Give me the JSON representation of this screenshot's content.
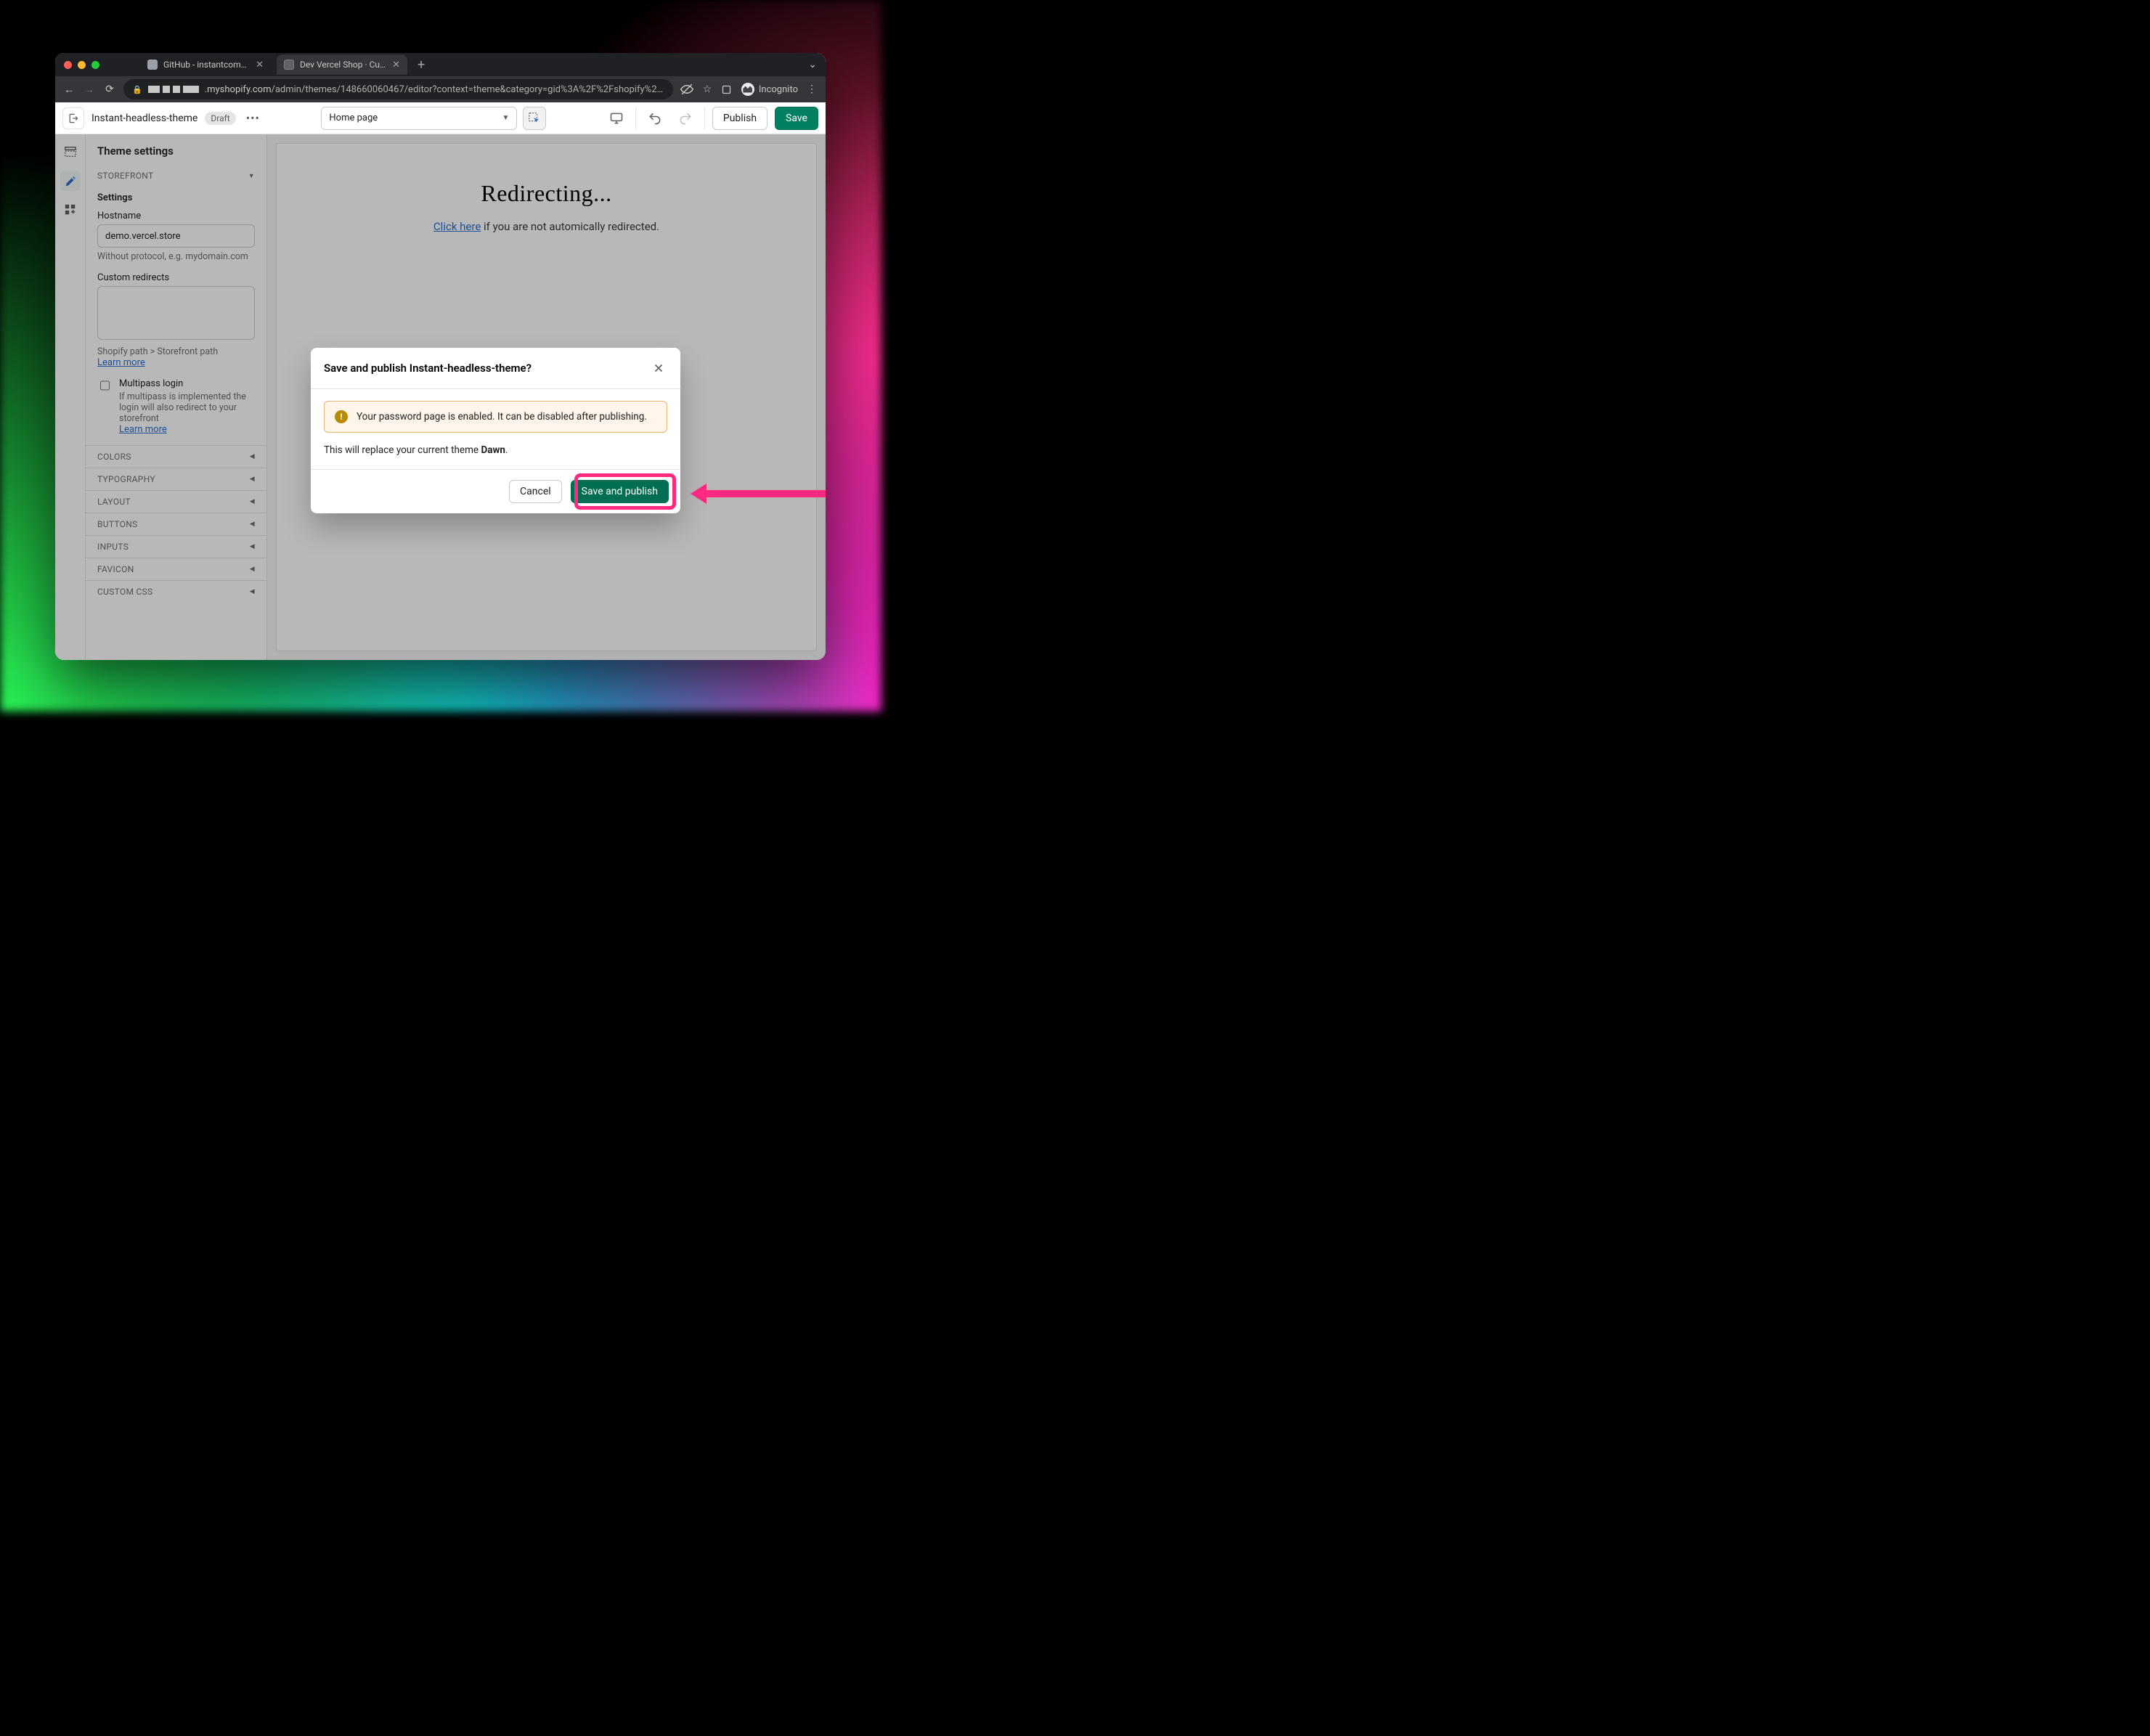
{
  "browser": {
    "tabs": [
      {
        "title": "GitHub - instantcommerce/sho"
      },
      {
        "title": "Dev Vercel Shop · Customize I"
      }
    ],
    "url_prefix": ".myshopify.com",
    "url_rest": "/admin/themes/148660060467/editor?context=theme&category=gid%3A%2F%2Fshopify%2FOnlineSto…",
    "incognito": "Incognito"
  },
  "appbar": {
    "theme_name": "Instant-headless-theme",
    "badge": "Draft",
    "page_select": "Home page",
    "publish": "Publish",
    "save": "Save"
  },
  "panel": {
    "title": "Theme settings",
    "sections": {
      "storefront": "Storefront",
      "colors": "Colors",
      "typography": "Typography",
      "layout": "Layout",
      "buttons": "Buttons",
      "inputs": "Inputs",
      "favicon": "Favicon",
      "custom_css": "Custom CSS"
    },
    "settings_heading": "Settings",
    "hostname_label": "Hostname",
    "hostname_value": "demo.vercel.store",
    "hostname_help": "Without protocol, e.g. mydomain.com",
    "redirects_label": "Custom redirects",
    "redirects_help": "Shopify path > Storefront path",
    "learn_more": "Learn more",
    "multipass_label": "Multipass login",
    "multipass_help": "If multipass is implemented the login will also redirect to your storefront"
  },
  "preview": {
    "heading": "Redirecting...",
    "link": "Click here",
    "rest": " if you are not automically redirected."
  },
  "modal": {
    "title": "Save and publish Instant-headless-theme?",
    "banner": "Your password page is enabled. It can be disabled after publishing.",
    "body_pre": "This will replace your current theme ",
    "body_bold": "Dawn",
    "body_post": ".",
    "cancel": "Cancel",
    "confirm": "Save and publish"
  }
}
